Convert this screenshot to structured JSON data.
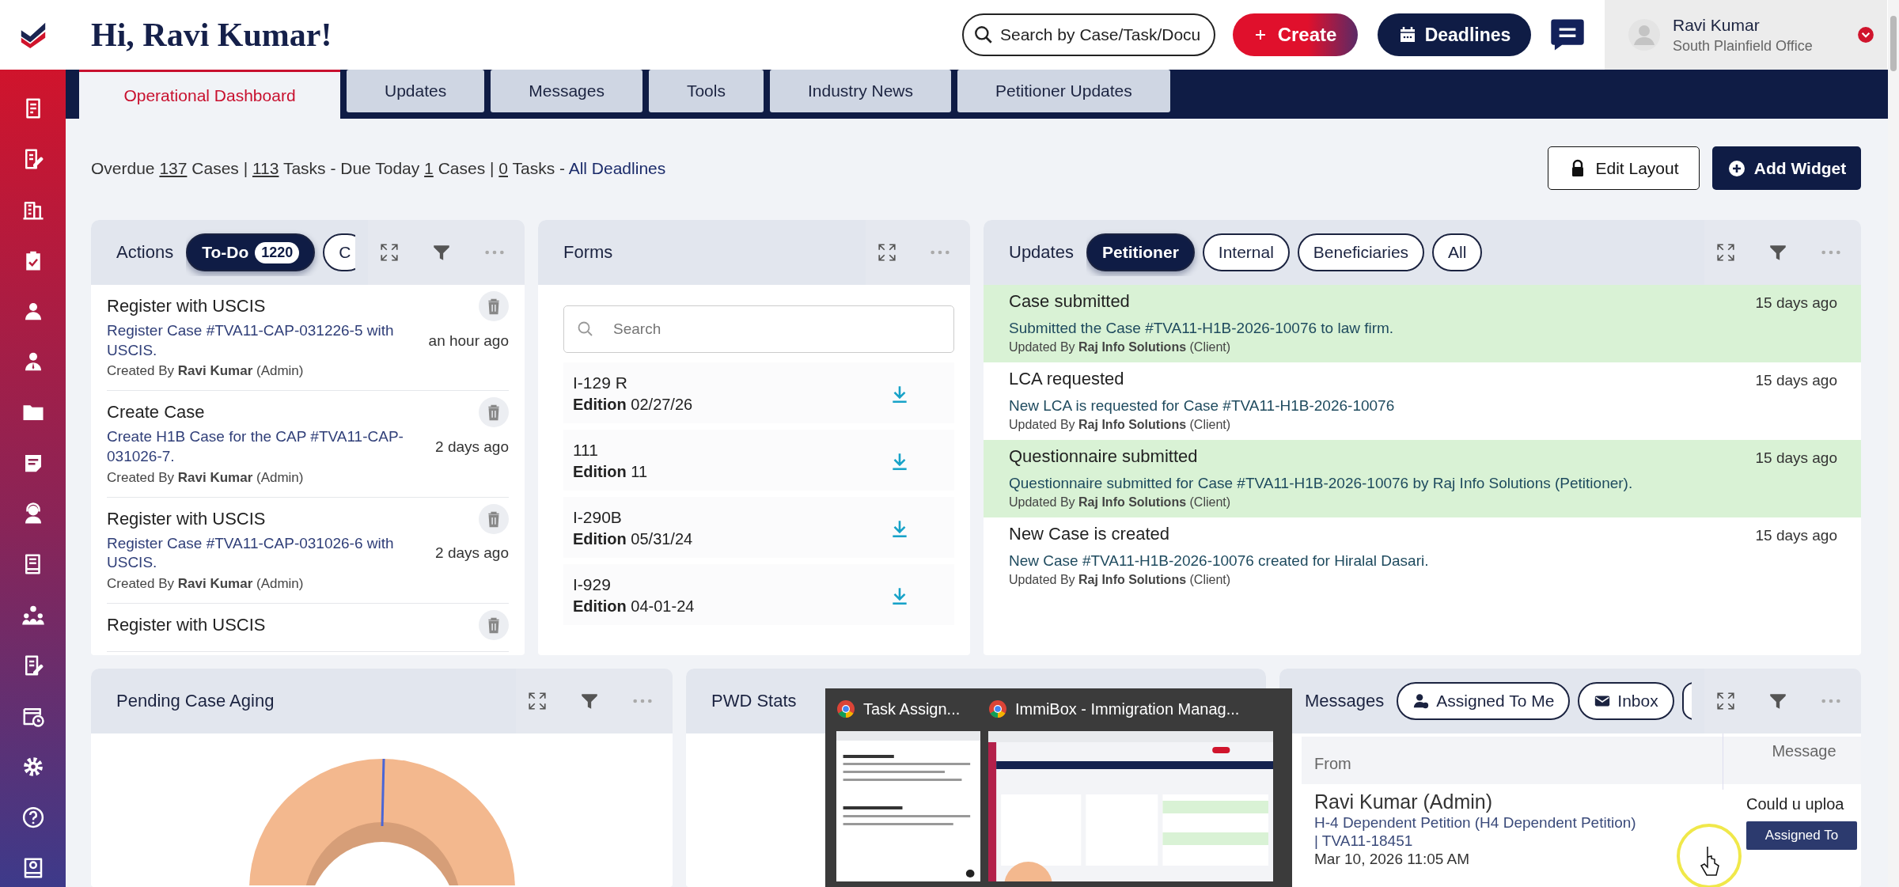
{
  "header": {
    "greeting": "Hi, Ravi Kumar!",
    "search": {
      "placeholder": "Search by Case/Task/Docu"
    },
    "create_button": "Create",
    "deadlines_button": "Deadlines",
    "user": {
      "name": "Ravi Kumar",
      "office": "South Plainfield Office"
    }
  },
  "tabs": [
    {
      "label": "Operational Dashboard",
      "selected": true
    },
    {
      "label": "Updates",
      "selected": false
    },
    {
      "label": "Messages",
      "selected": false
    },
    {
      "label": "Tools",
      "selected": false
    },
    {
      "label": "Industry News",
      "selected": false
    },
    {
      "label": "Petitioner Updates",
      "selected": false
    }
  ],
  "summary": [
    {
      "kind": "text",
      "text": "Overdue"
    },
    {
      "kind": "number",
      "text": "137"
    },
    {
      "kind": "text",
      "text": "Cases |"
    },
    {
      "kind": "number",
      "text": "113"
    },
    {
      "kind": "text",
      "text": "Tasks - Due Today"
    },
    {
      "kind": "number",
      "text": "1"
    },
    {
      "kind": "text",
      "text": "Cases |"
    },
    {
      "kind": "number",
      "text": "0"
    },
    {
      "kind": "text",
      "text": "Tasks -"
    },
    {
      "kind": "link",
      "text": "All Deadlines"
    }
  ],
  "toolbar": {
    "edit_layout": "Edit Layout",
    "add_widget": "Add Widget"
  },
  "actions_widget": {
    "title": "Actions",
    "filters": [
      {
        "label": "To-Do",
        "count": "1220",
        "selected": true
      },
      {
        "label": "C",
        "selected": false
      }
    ],
    "items": [
      {
        "title": "Register with USCIS",
        "description": "Register Case #TVA11-CAP-031226-5 with USCIS.",
        "created_by": "Created By **Ravi Kumar** (Admin)",
        "time": "an hour ago"
      },
      {
        "title": "Create Case",
        "description": "Create H1B Case for the CAP #TVA11-CAP-031026-7.",
        "created_by": "Created By **Ravi Kumar** (Admin)",
        "time": "2 days ago"
      },
      {
        "title": "Register with USCIS",
        "description": "Register Case #TVA11-CAP-031026-6 with USCIS.",
        "created_by": "Created By **Ravi Kumar** (Admin)",
        "time": "2 days ago"
      },
      {
        "title": "Register with USCIS"
      }
    ]
  },
  "forms_widget": {
    "title": "Forms",
    "search": {
      "placeholder": "Search"
    },
    "forms": [
      {
        "name": "I-129 R",
        "edition_label": "Edition",
        "edition": "02/27/26"
      },
      {
        "name": "111",
        "edition_label": "Edition",
        "edition": "11"
      },
      {
        "name": "I-290B",
        "edition_label": "Edition",
        "edition": "05/31/24"
      },
      {
        "name": "I-929",
        "edition_label": "Edition",
        "edition": "04-01-24"
      }
    ]
  },
  "updates_widget": {
    "title": "Updates",
    "filters": [
      {
        "label": "Petitioner",
        "selected": true
      },
      {
        "label": "Internal",
        "selected": false
      },
      {
        "label": "Beneficiaries",
        "selected": false
      },
      {
        "label": "All",
        "selected": false
      }
    ],
    "items": [
      {
        "title": "Case submitted",
        "time": "15 days ago",
        "description": "Submitted the Case #TVA11-H1B-2026-10076 to law firm.",
        "updated_by": "Updated By **Raj Info Solutions** (Client)",
        "highlighted": true
      },
      {
        "title": "LCA requested",
        "time": "15 days ago",
        "description": "New LCA is requested for Case #TVA11-H1B-2026-10076",
        "updated_by": "Updated By **Raj Info Solutions** (Client)",
        "highlighted": false
      },
      {
        "title": "Questionnaire submitted",
        "time": "15 days ago",
        "description": "Questionnaire submitted for Case #TVA11-H1B-2026-10076 by Raj Info Solutions (Petitioner).",
        "updated_by": "Updated By **Raj Info Solutions** (Client)",
        "highlighted": true
      },
      {
        "title": "New Case is created",
        "time": "15 days ago",
        "description": "New Case #TVA11-H1B-2026-10076 created for Hiralal Dasari.",
        "updated_by": "Updated By **Raj Info Solutions** (Client)",
        "highlighted": false
      }
    ]
  },
  "aging_widget": {
    "title": "Pending Case Aging"
  },
  "pwd_widget": {
    "title": "PWD Stats"
  },
  "messages_widget": {
    "title": "Messages",
    "filters": [
      {
        "label": "Assigned To Me",
        "kind": "person",
        "selected": false
      },
      {
        "label": "Inbox",
        "kind": "mail",
        "selected": false
      }
    ],
    "columns": [
      "From",
      "Message"
    ],
    "rows": [
      {
        "from": "Ravi Kumar (Admin)",
        "subject": "H-4 Dependent Petition (H4 Dependent Petition)",
        "case": "| TVA11-18451",
        "date": "Mar 10, 2026 11:05 AM",
        "message": "Could u uploa",
        "action": "Assigned To"
      }
    ]
  },
  "taskbar_preview": {
    "windows": [
      {
        "title": "Task Assign..."
      },
      {
        "title": "ImmiBox - Immigration Manag..."
      }
    ]
  }
}
